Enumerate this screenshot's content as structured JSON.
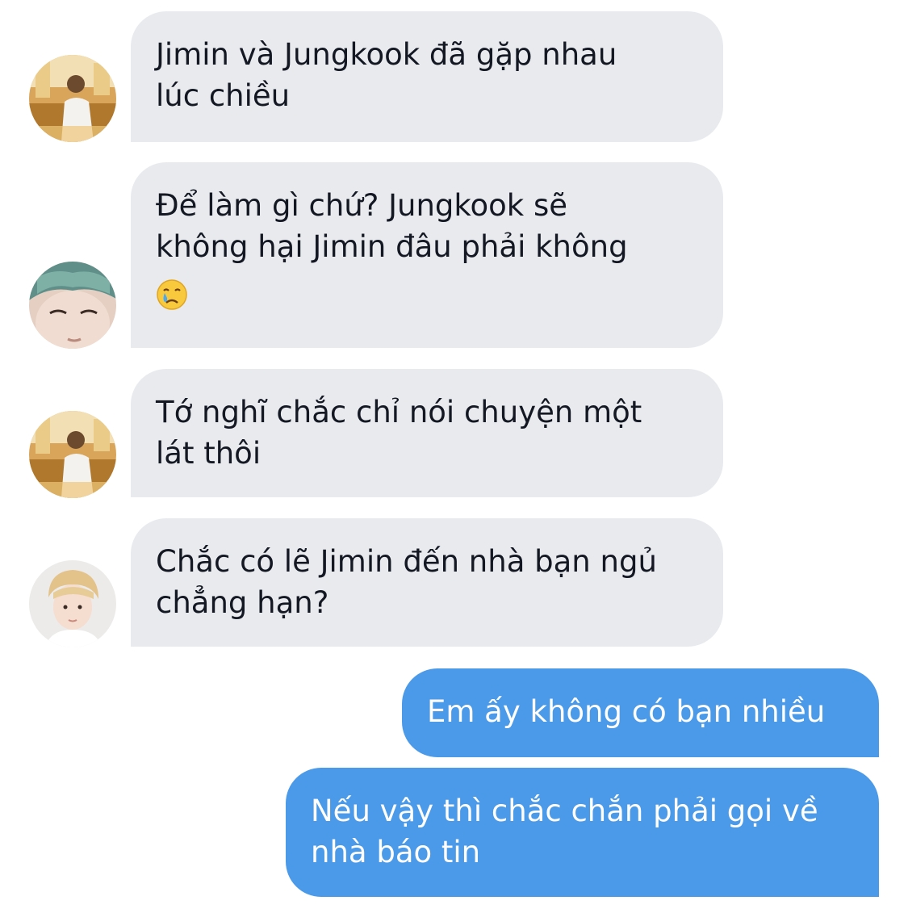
{
  "colors": {
    "incoming_bubble": "#e8eaee",
    "outgoing_bubble": "#4a9ae9",
    "incoming_text": "#141823",
    "outgoing_text": "#ffffff"
  },
  "messages": [
    {
      "sender": "incoming",
      "avatar": "avatar-photo-warm",
      "lines": [
        "Jimin và Jungkook đã gặp nhau",
        "lúc chiều"
      ]
    },
    {
      "sender": "incoming",
      "avatar": "avatar-photo-teal-hair",
      "lines": [
        "Để làm gì chứ? Jungkook sẽ",
        "không hại Jimin đâu phải không"
      ],
      "emoji": "crying-face-emoji"
    },
    {
      "sender": "incoming",
      "avatar": "avatar-photo-warm",
      "lines": [
        "Tớ nghĩ chắc chỉ nói chuyện một",
        "lát thôi"
      ]
    },
    {
      "sender": "incoming",
      "avatar": "avatar-photo-blond",
      "lines": [
        "Chắc có lẽ Jimin đến nhà bạn ngủ",
        "chẳng hạn?"
      ]
    },
    {
      "sender": "outgoing",
      "lines": [
        "Em ấy không có bạn nhiều"
      ]
    },
    {
      "sender": "outgoing",
      "lines": [
        "Nếu vậy thì chắc chắn phải gọi về",
        "nhà báo tin"
      ]
    }
  ]
}
